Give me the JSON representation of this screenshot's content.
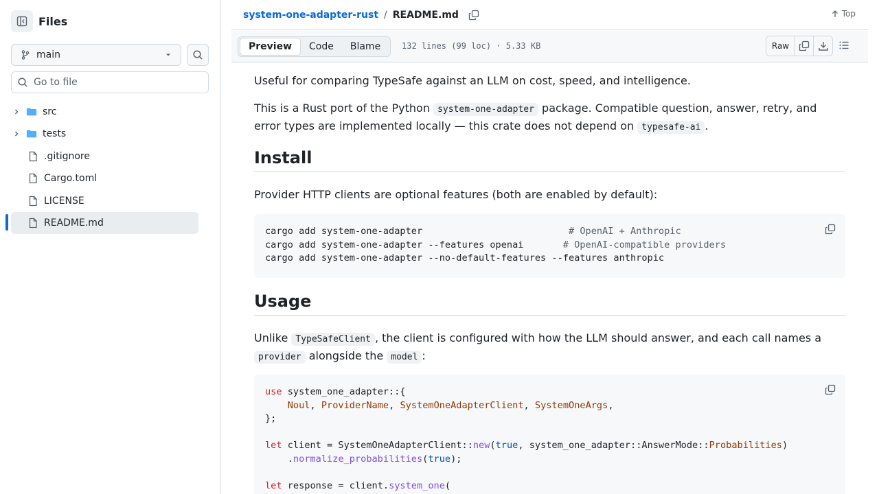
{
  "sidebar": {
    "title": "Files",
    "branch": "main",
    "goto_placeholder": "Go to file",
    "items": [
      {
        "name": "src",
        "type": "folder"
      },
      {
        "name": "tests",
        "type": "folder"
      },
      {
        "name": ".gitignore",
        "type": "file"
      },
      {
        "name": "Cargo.toml",
        "type": "file"
      },
      {
        "name": "LICENSE",
        "type": "file"
      },
      {
        "name": "README.md",
        "type": "file",
        "selected": true
      }
    ]
  },
  "header": {
    "repo": "system-one-adapter-rust",
    "separator": "/",
    "file": "README.md",
    "top_label": "Top"
  },
  "filebar": {
    "tabs": [
      "Preview",
      "Code",
      "Blame"
    ],
    "active_tab": "Preview",
    "meta": "132 lines (99 loc) · 5.33 KB",
    "raw_label": "Raw"
  },
  "readme": {
    "p1": "Useful for comparing TypeSafe against an LLM on cost, speed, and intelligence.",
    "p2_a": "This is a Rust port of the Python ",
    "p2_code": "system-one-adapter",
    "p2_b": " package. Compatible question, answer, retry, and error types are implemented locally — this crate does not depend on ",
    "p2_code2": "typesafe-ai",
    "p2_c": ".",
    "h_install": "Install",
    "p3": "Provider HTTP clients are optional features (both are enabled by default):",
    "install_lines": [
      {
        "cmd": "cargo add system-one-adapter                          ",
        "comment": "# OpenAI + Anthropic"
      },
      {
        "cmd": "cargo add system-one-adapter --features openai       ",
        "comment": "# OpenAI-compatible providers"
      },
      {
        "cmd": "cargo add system-one-adapter --no-default-features --features anthropic",
        "comment": ""
      }
    ],
    "h_usage": "Usage",
    "p4_a": "Unlike ",
    "p4_code1": "TypeSafeClient",
    "p4_b": ", the client is configured with how the LLM should answer, and each call names a ",
    "p4_code2": "provider",
    "p4_c": " alongside the ",
    "p4_code3": "model",
    "p4_d": ":",
    "code": {
      "l1_kw": "use",
      "l1_rest": " system_one_adapter::{",
      "l2_indent": "    ",
      "l2_t1": "Noul",
      "l2_t2": "ProviderName",
      "l2_t3": "SystemOneAdapterClient",
      "l2_t4": "SystemOneArgs",
      "l3": "};",
      "l5_kw": "let",
      "l5_a": " client = SystemOneAdapterClient::",
      "l5_fn": "new",
      "l5_b": "(",
      "l5_true": "true",
      "l5_c": ", system_one_adapter::AnswerMode::",
      "l5_ty": "Probabilities",
      "l5_d": ")",
      "l6_indent": "    .",
      "l6_fn": "normalize_probabilities",
      "l6_a": "(",
      "l6_true": "true",
      "l6_b": ");",
      "l8_kw": "let",
      "l8_a": " response = client.",
      "l8_fn": "system_one",
      "l8_b": "("
    }
  }
}
